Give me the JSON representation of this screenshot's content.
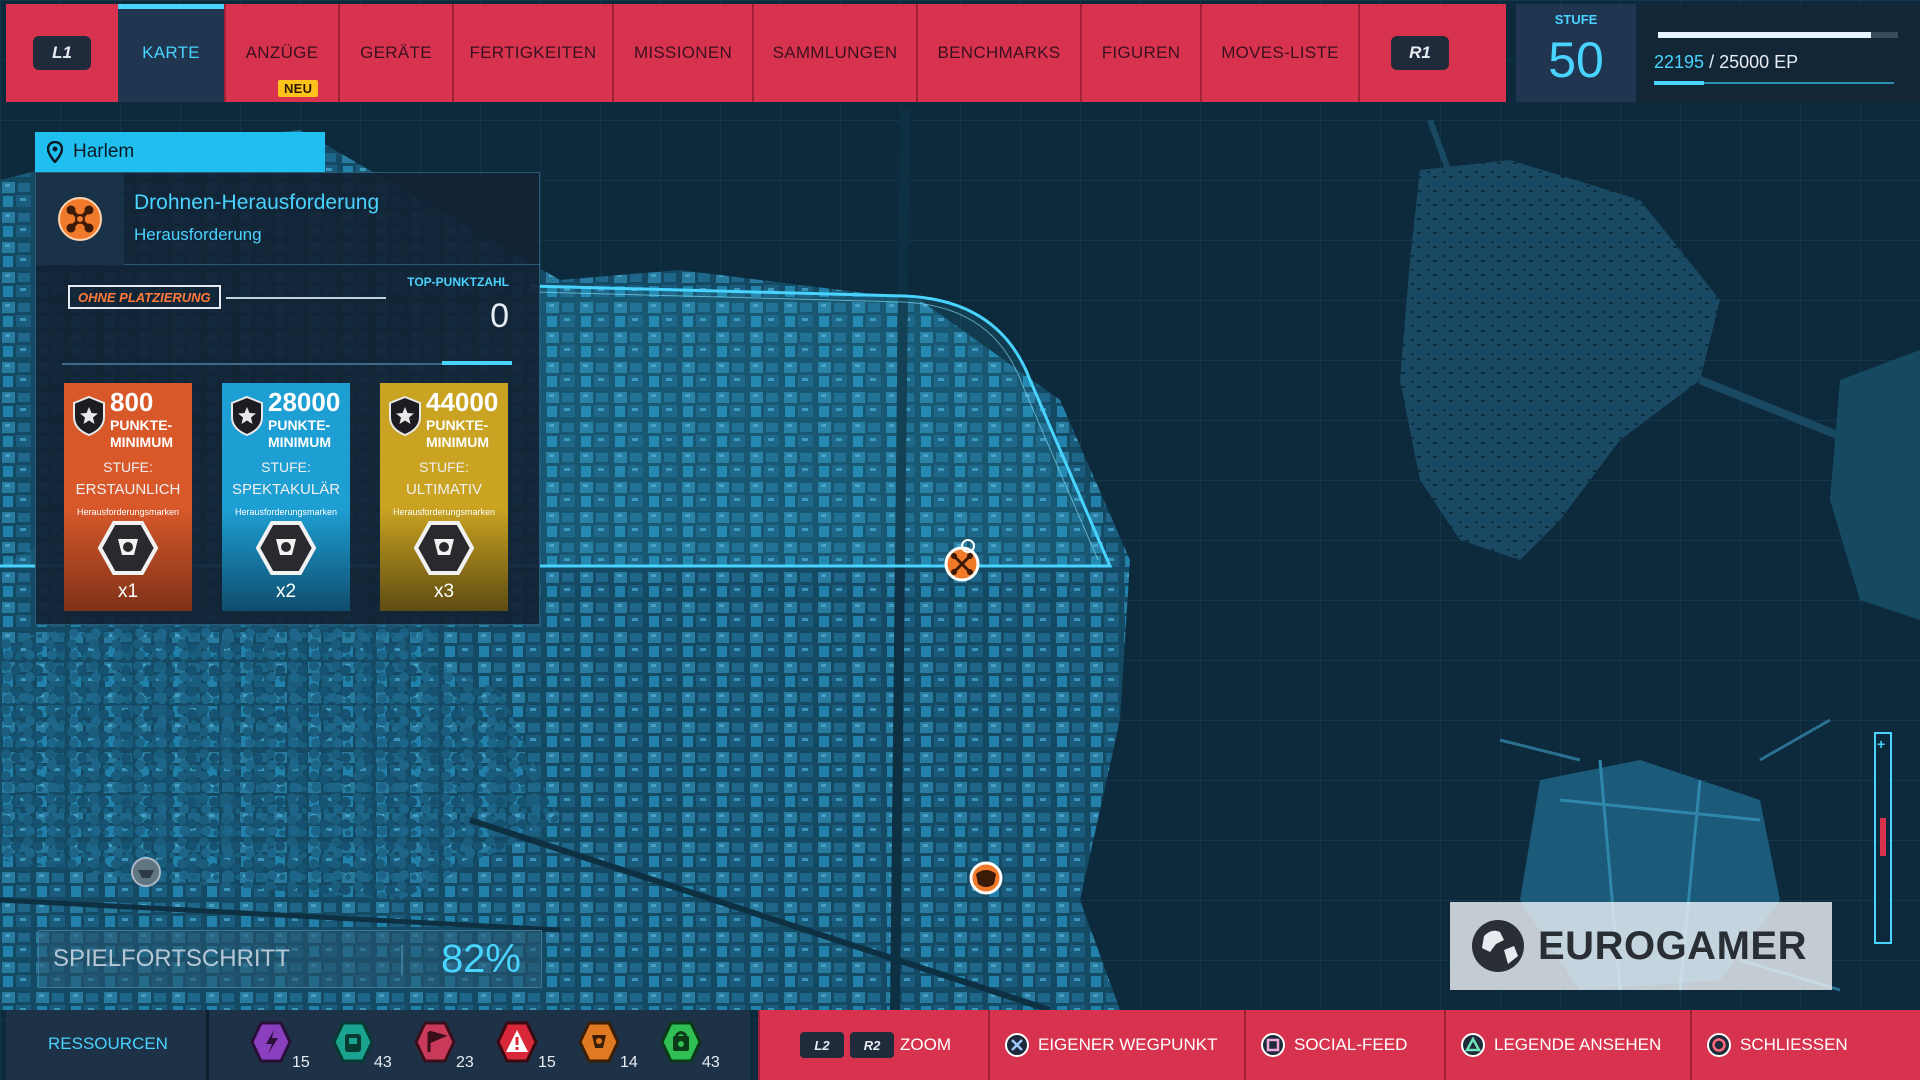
{
  "nav": {
    "left_key": "L1",
    "right_key": "R1",
    "tabs": [
      {
        "label": "KARTE",
        "active": true
      },
      {
        "label": "ANZÜGE",
        "badge": "NEU"
      },
      {
        "label": "GERÄTE"
      },
      {
        "label": "FERTIGKEITEN"
      },
      {
        "label": "MISSIONEN"
      },
      {
        "label": "SAMMLUNGEN"
      },
      {
        "label": "BENCHMARKS"
      },
      {
        "label": "FIGUREN"
      },
      {
        "label": "MOVES-LISTE"
      }
    ]
  },
  "level": {
    "label": "STUFE",
    "value": "50"
  },
  "xp": {
    "current": "22195",
    "separator": " / ",
    "max": "25000 EP",
    "fraction": 0.888
  },
  "location": {
    "name": "Harlem"
  },
  "activity": {
    "title": "Drohnen-Herausforderung",
    "subtitle": "Herausforderung",
    "icon": "drone-icon",
    "rank_label": "OHNE PLATZIERUNG",
    "top_score_label": "TOP-PUNKTZAHL",
    "top_score": "0",
    "tiers": [
      {
        "points": "800",
        "line1": "PUNKTE-",
        "line2": "MINIMUM",
        "stage_label": "STUFE:",
        "stage": "ERSTAUNLICH",
        "marks_label": "Herausforderungsmarken",
        "count": "x1",
        "color": "#d8582a",
        "color2": "#7e3218"
      },
      {
        "points": "28000",
        "line1": "PUNKTE-",
        "line2": "MINIMUM",
        "stage_label": "STUFE:",
        "stage": "SPEKTAKULÄR",
        "marks_label": "Herausforderungsmarken",
        "count": "x2",
        "color": "#1e9fd3",
        "color2": "#0e4d6e"
      },
      {
        "points": "44000",
        "line1": "PUNKTE-",
        "line2": "MINIMUM",
        "stage_label": "STUFE:",
        "stage": "ULTIMATIV",
        "marks_label": "Herausforderungsmarken",
        "count": "x3",
        "color": "#c9a321",
        "color2": "#5e4c12"
      }
    ]
  },
  "progress": {
    "label": "SPIELFORTSCHRITT",
    "value": "82%"
  },
  "resources": {
    "label": "RESSOURCEN",
    "items": [
      {
        "icon": "research-token-icon",
        "count": "15",
        "color": "#8a3fbf"
      },
      {
        "icon": "backpack-token-icon",
        "count": "43",
        "color": "#1aa38e"
      },
      {
        "icon": "landmark-token-icon",
        "count": "23",
        "color": "#c93a5a"
      },
      {
        "icon": "crime-token-icon",
        "count": "15",
        "color": "#d8283a"
      },
      {
        "icon": "challenge-token-icon",
        "count": "14",
        "color": "#e07a22"
      },
      {
        "icon": "base-token-icon",
        "count": "43",
        "color": "#2fbf55"
      }
    ]
  },
  "controls": [
    {
      "keys": [
        "L2",
        "R2"
      ],
      "label": "ZOOM"
    },
    {
      "icon": "cross-button-icon",
      "label": "EIGENER WEGPUNKT"
    },
    {
      "icon": "square-button-icon",
      "label": "SOCIAL-FEED"
    },
    {
      "icon": "triangle-button-icon",
      "label": "LEGENDE ANSEHEN"
    },
    {
      "icon": "circle-button-icon",
      "label": "SCHLIESSEN"
    }
  ],
  "watermark": {
    "text": "EUROGAMER"
  },
  "colors": {
    "accent": "#49d3ff",
    "nav_red": "#d8334e",
    "panel": "#122234"
  }
}
